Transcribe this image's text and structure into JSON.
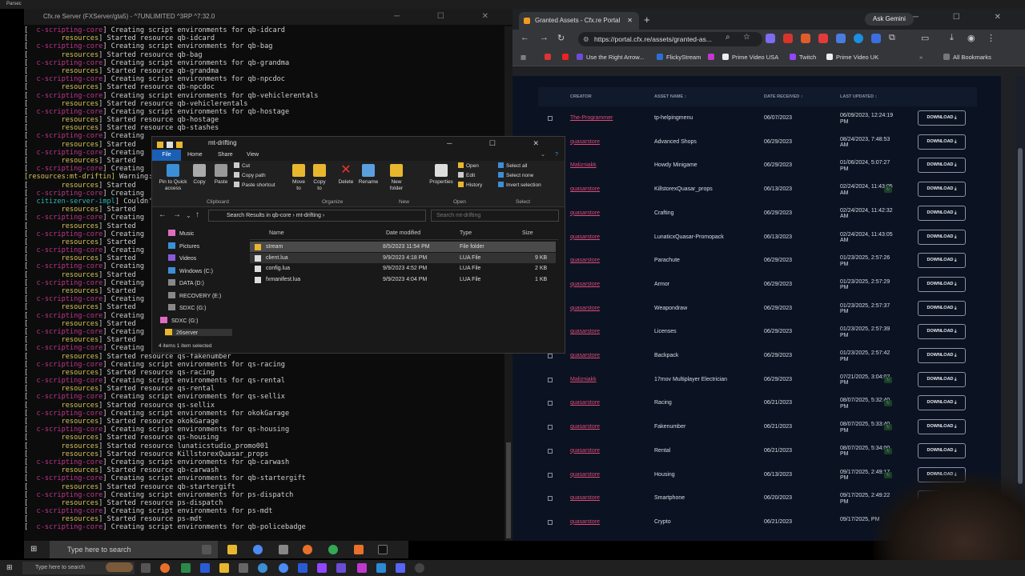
{
  "parsec": {
    "title": "Parsec"
  },
  "console": {
    "title": "Cfx.re Server (FXServer/gta5) - ^7UNLIMITED ^3RP ^7:32.0",
    "lines": [
      [
        [
          "b",
          "[  "
        ],
        [
          "c",
          "c-scripting-core"
        ],
        [
          "b",
          "] Creating script environments for qb-idcard"
        ]
      ],
      [
        [
          "b",
          "[        "
        ],
        [
          "y",
          "resources"
        ],
        [
          "b",
          "] Started resource qb-idcard"
        ]
      ],
      [
        [
          "b",
          "[  "
        ],
        [
          "c",
          "c-scripting-core"
        ],
        [
          "b",
          "] Creating script environments for qb-bag"
        ]
      ],
      [
        [
          "b",
          "[        "
        ],
        [
          "y",
          "resources"
        ],
        [
          "b",
          "] Started resource qb-bag"
        ]
      ],
      [
        [
          "b",
          "[  "
        ],
        [
          "c",
          "c-scripting-core"
        ],
        [
          "b",
          "] Creating script environments for qb-grandma"
        ]
      ],
      [
        [
          "b",
          "[        "
        ],
        [
          "y",
          "resources"
        ],
        [
          "b",
          "] Started resource qb-grandma"
        ]
      ],
      [
        [
          "b",
          "[  "
        ],
        [
          "c",
          "c-scripting-core"
        ],
        [
          "b",
          "] Creating script environments for qb-npcdoc"
        ]
      ],
      [
        [
          "b",
          "[        "
        ],
        [
          "y",
          "resources"
        ],
        [
          "b",
          "] Started resource qb-npcdoc"
        ]
      ],
      [
        [
          "b",
          "[  "
        ],
        [
          "c",
          "c-scripting-core"
        ],
        [
          "b",
          "] Creating script environments for qb-vehiclerentals"
        ]
      ],
      [
        [
          "b",
          "[        "
        ],
        [
          "y",
          "resources"
        ],
        [
          "b",
          "] Started resource qb-vehiclerentals"
        ]
      ],
      [
        [
          "b",
          "[  "
        ],
        [
          "c",
          "c-scripting-core"
        ],
        [
          "b",
          "] Creating script environments for qb-hostage"
        ]
      ],
      [
        [
          "b",
          "[        "
        ],
        [
          "y",
          "resources"
        ],
        [
          "b",
          "] Started resource qb-hostage"
        ]
      ],
      [
        [
          "b",
          "[        "
        ],
        [
          "y",
          "resources"
        ],
        [
          "b",
          "] Started resource qb-stashes"
        ]
      ],
      [
        [
          "b",
          "[  "
        ],
        [
          "c",
          "c-scripting-core"
        ],
        [
          "b",
          "] Creating"
        ]
      ],
      [
        [
          "b",
          "[        "
        ],
        [
          "y",
          "resources"
        ],
        [
          "b",
          "] Started"
        ]
      ],
      [
        [
          "b",
          "[  "
        ],
        [
          "c",
          "c-scripting-core"
        ],
        [
          "b",
          "] Creating"
        ]
      ],
      [
        [
          "b",
          "[        "
        ],
        [
          "y",
          "resources"
        ],
        [
          "b",
          "] Started"
        ]
      ],
      [
        [
          "b",
          "[  "
        ],
        [
          "c",
          "c-scripting-core"
        ],
        [
          "b",
          "] Creating"
        ]
      ],
      [
        [
          "y",
          "[resources:mt-driftin]"
        ],
        [
          "b",
          " Warning:"
        ]
      ],
      [
        [
          "b",
          "[        "
        ],
        [
          "y",
          "resources"
        ],
        [
          "b",
          "] Started"
        ]
      ],
      [
        [
          "b",
          "[  "
        ],
        [
          "c",
          "c-scripting-core"
        ],
        [
          "b",
          "] Creating"
        ]
      ],
      [
        [
          "b",
          "[  "
        ],
        [
          "t",
          "citizen-server-impl"
        ],
        [
          "b",
          "] Couldn't"
        ]
      ],
      [
        [
          "b",
          "[        "
        ],
        [
          "y",
          "resources"
        ],
        [
          "b",
          "] Started"
        ]
      ],
      [
        [
          "b",
          "[  "
        ],
        [
          "c",
          "c-scripting-core"
        ],
        [
          "b",
          "] Creating"
        ]
      ],
      [
        [
          "b",
          "[        "
        ],
        [
          "y",
          "resources"
        ],
        [
          "b",
          "] Started"
        ]
      ],
      [
        [
          "b",
          "[  "
        ],
        [
          "c",
          "c-scripting-core"
        ],
        [
          "b",
          "] Creating"
        ]
      ],
      [
        [
          "b",
          "[        "
        ],
        [
          "y",
          "resources"
        ],
        [
          "b",
          "] Started"
        ]
      ],
      [
        [
          "b",
          "[  "
        ],
        [
          "c",
          "c-scripting-core"
        ],
        [
          "b",
          "] Creating"
        ]
      ],
      [
        [
          "b",
          "[        "
        ],
        [
          "y",
          "resources"
        ],
        [
          "b",
          "] Started"
        ]
      ],
      [
        [
          "b",
          "[  "
        ],
        [
          "c",
          "c-scripting-core"
        ],
        [
          "b",
          "] Creating"
        ]
      ],
      [
        [
          "b",
          "[        "
        ],
        [
          "y",
          "resources"
        ],
        [
          "b",
          "] Started"
        ]
      ],
      [
        [
          "b",
          "[  "
        ],
        [
          "c",
          "c-scripting-core"
        ],
        [
          "b",
          "] Creating"
        ]
      ],
      [
        [
          "b",
          "[        "
        ],
        [
          "y",
          "resources"
        ],
        [
          "b",
          "] Started"
        ]
      ],
      [
        [
          "b",
          "[  "
        ],
        [
          "c",
          "c-scripting-core"
        ],
        [
          "b",
          "] Creating"
        ]
      ],
      [
        [
          "b",
          "[        "
        ],
        [
          "y",
          "resources"
        ],
        [
          "b",
          "] Started"
        ]
      ],
      [
        [
          "b",
          "[  "
        ],
        [
          "c",
          "c-scripting-core"
        ],
        [
          "b",
          "] Creating"
        ]
      ],
      [
        [
          "b",
          "[        "
        ],
        [
          "y",
          "resources"
        ],
        [
          "b",
          "] Started"
        ]
      ],
      [
        [
          "b",
          "[  "
        ],
        [
          "c",
          "c-scripting-core"
        ],
        [
          "b",
          "] Creating"
        ]
      ],
      [
        [
          "b",
          "[        "
        ],
        [
          "y",
          "resources"
        ],
        [
          "b",
          "] Started"
        ]
      ],
      [
        [
          "b",
          "[  "
        ],
        [
          "c",
          "c-scripting-core"
        ],
        [
          "b",
          "] Creating"
        ]
      ],
      [
        [
          "b",
          "[        "
        ],
        [
          "y",
          "resources"
        ],
        [
          "b",
          "] Started resource qs-fakenumber"
        ]
      ],
      [
        [
          "b",
          "[  "
        ],
        [
          "c",
          "c-scripting-core"
        ],
        [
          "b",
          "] Creating script environments for qs-racing"
        ]
      ],
      [
        [
          "b",
          "[        "
        ],
        [
          "y",
          "resources"
        ],
        [
          "b",
          "] Started resource qs-racing"
        ]
      ],
      [
        [
          "b",
          "[  "
        ],
        [
          "c",
          "c-scripting-core"
        ],
        [
          "b",
          "] Creating script environments for qs-rental"
        ]
      ],
      [
        [
          "b",
          "[        "
        ],
        [
          "y",
          "resources"
        ],
        [
          "b",
          "] Started resource qs-rental"
        ]
      ],
      [
        [
          "b",
          "[  "
        ],
        [
          "c",
          "c-scripting-core"
        ],
        [
          "b",
          "] Creating script environments for qs-sellix"
        ]
      ],
      [
        [
          "b",
          "[        "
        ],
        [
          "y",
          "resources"
        ],
        [
          "b",
          "] Started resource qs-sellix"
        ]
      ],
      [
        [
          "b",
          "[  "
        ],
        [
          "c",
          "c-scripting-core"
        ],
        [
          "b",
          "] Creating script environments for okokGarage"
        ]
      ],
      [
        [
          "b",
          "[        "
        ],
        [
          "y",
          "resources"
        ],
        [
          "b",
          "] Started resource okokGarage"
        ]
      ],
      [
        [
          "b",
          "[  "
        ],
        [
          "c",
          "c-scripting-core"
        ],
        [
          "b",
          "] Creating script environments for qs-housing"
        ]
      ],
      [
        [
          "b",
          "[        "
        ],
        [
          "y",
          "resources"
        ],
        [
          "b",
          "] Started resource qs-housing"
        ]
      ],
      [
        [
          "b",
          "[        "
        ],
        [
          "y",
          "resources"
        ],
        [
          "b",
          "] Started resource lunaticstudio_promo001"
        ]
      ],
      [
        [
          "b",
          "[        "
        ],
        [
          "y",
          "resources"
        ],
        [
          "b",
          "] Started resource KillstorexQuasar_props"
        ]
      ],
      [
        [
          "b",
          "[  "
        ],
        [
          "c",
          "c-scripting-core"
        ],
        [
          "b",
          "] Creating script environments for qb-carwash"
        ]
      ],
      [
        [
          "b",
          "[        "
        ],
        [
          "y",
          "resources"
        ],
        [
          "b",
          "] Started resource qb-carwash"
        ]
      ],
      [
        [
          "b",
          "[  "
        ],
        [
          "c",
          "c-scripting-core"
        ],
        [
          "b",
          "] Creating script environments for qb-startergift"
        ]
      ],
      [
        [
          "b",
          "[        "
        ],
        [
          "y",
          "resources"
        ],
        [
          "b",
          "] Started resource qb-startergift"
        ]
      ],
      [
        [
          "b",
          "[  "
        ],
        [
          "c",
          "c-scripting-core"
        ],
        [
          "b",
          "] Creating script environments for ps-dispatch"
        ]
      ],
      [
        [
          "b",
          "[        "
        ],
        [
          "y",
          "resources"
        ],
        [
          "b",
          "] Started resource ps-dispatch"
        ]
      ],
      [
        [
          "b",
          "[  "
        ],
        [
          "c",
          "c-scripting-core"
        ],
        [
          "b",
          "] Creating script environments for ps-mdt"
        ]
      ],
      [
        [
          "b",
          "[        "
        ],
        [
          "y",
          "resources"
        ],
        [
          "b",
          "] Started resource ps-mdt"
        ]
      ],
      [
        [
          "b",
          "[  "
        ],
        [
          "c",
          "c-scripting-core"
        ],
        [
          "b",
          "] Creating script environments for qb-policebadge"
        ]
      ]
    ]
  },
  "browser": {
    "tab_title": "Granted Assets - Cfx.re Portal",
    "gemini": "Ask Gemini",
    "url": "https://portal.cfx.re/assets/granted-as...",
    "bookmarks": [
      "Use the Right Arrow...",
      "FlickyStream",
      "Prime Video USA",
      "Twitch",
      "Prime Video UK",
      "All Bookmarks"
    ],
    "table_headers": {
      "creator": "CREATOR",
      "asset": "ASSET NAME ↕",
      "date": "DATE RECEIVED ↕",
      "updated": "LAST UPDATED ↕"
    },
    "download_label": "DOWNLOAD ⤓",
    "rows": [
      {
        "creator": "The-Programmer",
        "asset": "tp-helpingmenu",
        "date": "06/07/2023",
        "updated": "06/09/2023, 12:24:19 PM",
        "badge": false
      },
      {
        "creator": "quasarstore",
        "asset": "Advanced Shops",
        "date": "06/29/2023",
        "updated": "08/24/2023, 7:48:53 AM",
        "badge": false
      },
      {
        "creator": "Malizniakk",
        "asset": "Howdy Minigame",
        "date": "06/29/2023",
        "updated": "01/06/2024, 5:07:27 PM",
        "badge": false
      },
      {
        "creator": "quasarstore",
        "asset": "KillstorexQuasar_props",
        "date": "06/13/2023",
        "updated": "02/24/2024, 11:43:05 AM",
        "badge": true
      },
      {
        "creator": "quasarstore",
        "asset": "Crafting",
        "date": "06/29/2023",
        "updated": "02/24/2024, 11:42:32 AM",
        "badge": false
      },
      {
        "creator": "quasarstore",
        "asset": "LunaticxQuasar-Promopack",
        "date": "06/13/2023",
        "updated": "02/24/2024, 11:43:05 AM",
        "badge": false
      },
      {
        "creator": "quasarstore",
        "asset": "Parachute",
        "date": "06/29/2023",
        "updated": "01/23/2025, 2:57:26 PM",
        "badge": false
      },
      {
        "creator": "quasarstore",
        "asset": "Armor",
        "date": "06/29/2023",
        "updated": "01/23/2025, 2:57:29 PM",
        "badge": false
      },
      {
        "creator": "quasarstore",
        "asset": "Weapondraw",
        "date": "06/29/2023",
        "updated": "01/23/2025, 2:57:37 PM",
        "badge": false
      },
      {
        "creator": "quasarstore",
        "asset": "Licenses",
        "date": "06/29/2023",
        "updated": "01/23/2025, 2:57:39 PM",
        "badge": false
      },
      {
        "creator": "quasarstore",
        "asset": "Backpack",
        "date": "06/29/2023",
        "updated": "01/23/2025, 2:57:42 PM",
        "badge": false
      },
      {
        "creator": "Malizniakk",
        "asset": "17mov Multiplayer Electrician",
        "date": "06/29/2023",
        "updated": "07/21/2025, 3:04:02 PM",
        "badge": true
      },
      {
        "creator": "quasarstore",
        "asset": "Racing",
        "date": "06/21/2023",
        "updated": "08/07/2025, 5:32:40 PM",
        "badge": true
      },
      {
        "creator": "quasarstore",
        "asset": "Fakenumber",
        "date": "06/21/2023",
        "updated": "08/07/2025, 5:33:40 PM",
        "badge": true
      },
      {
        "creator": "quasarstore",
        "asset": "Rental",
        "date": "06/21/2023",
        "updated": "08/07/2025, 5:34:00 PM",
        "badge": true
      },
      {
        "creator": "quasarstore",
        "asset": "Housing",
        "date": "06/13/2023",
        "updated": "09/17/2025, 2:49:17 PM",
        "badge": true
      },
      {
        "creator": "quasarstore",
        "asset": "Smartphone",
        "date": "06/20/2023",
        "updated": "09/17/2025, 2:49:22 PM",
        "badge": false
      },
      {
        "creator": "quasarstore",
        "asset": "Crypto",
        "date": "06/21/2023",
        "updated": "09/17/2025, PM",
        "badge": false
      }
    ]
  },
  "explorer": {
    "title": "mt-drifting",
    "tabs": [
      "File",
      "Home",
      "Share",
      "View"
    ],
    "ribbon": {
      "pin": "Pin to Quick access",
      "copy": "Copy",
      "paste": "Paste",
      "cut": "Cut",
      "copy_path": "Copy path",
      "paste_shortcut": "Paste shortcut",
      "move_to": "Move to",
      "copy_to": "Copy to",
      "delete": "Delete",
      "rename": "Rename",
      "new_folder": "New folder",
      "properties": "Properties",
      "open": "Open",
      "edit": "Edit",
      "history": "History",
      "select_all": "Select all",
      "select_none": "Select none",
      "invert_selection": "Invert selection",
      "groups": [
        "Clipboard",
        "Organize",
        "New",
        "Open",
        "Select"
      ]
    },
    "path": "Search Results in qb-core  ›  mt-drifting  ›",
    "search_placeholder": "Search mt-drifting",
    "nav": [
      "Music",
      "Pictures",
      "Videos",
      "Windows (C:)",
      "DATA (D:)",
      "RECOVERY (E:)",
      "SDXC (G:)",
      "SDXC (G:)",
      "26server"
    ],
    "columns": {
      "name": "Name",
      "date": "Date modified",
      "type": "Type",
      "size": "Size"
    },
    "files": [
      {
        "name": "stream",
        "date": "8/5/2023 11:54 PM",
        "type": "File folder",
        "size": "",
        "folder": true
      },
      {
        "name": "client.lua",
        "date": "9/9/2023 4:18 PM",
        "type": "LUA File",
        "size": "9 KB",
        "folder": false
      },
      {
        "name": "config.lua",
        "date": "9/9/2023 4:52 PM",
        "type": "LUA File",
        "size": "2 KB",
        "folder": false
      },
      {
        "name": "fxmanifest.lua",
        "date": "9/9/2023 4:04 PM",
        "type": "LUA File",
        "size": "1 KB",
        "folder": false
      }
    ],
    "status": "4 items    1 item selected"
  },
  "taskbar": {
    "search1": "Type here to search",
    "search2": "Type here to search"
  }
}
